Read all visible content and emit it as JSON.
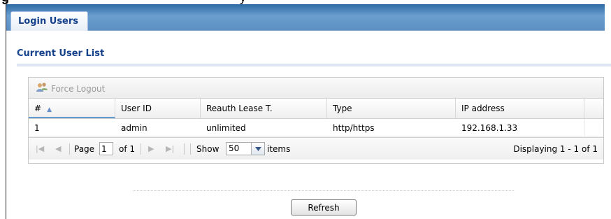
{
  "caption": {
    "prefix": "g",
    "text": "y"
  },
  "tabs": [
    {
      "label": "Login Users",
      "active": true
    }
  ],
  "section": {
    "title": "Current User List"
  },
  "toolbar": {
    "force_logout_label": "Force Logout",
    "force_logout_enabled": false,
    "icon": "users-icon"
  },
  "table": {
    "columns": [
      "#",
      "User ID",
      "Reauth Lease T.",
      "Type",
      "IP address"
    ],
    "sort_column": "#",
    "sort_direction": "ascending",
    "rows": [
      {
        "index": "1",
        "user_id": "admin",
        "reauth": "unlimited",
        "type": "http/https",
        "ip": "192.168.1.33"
      }
    ]
  },
  "pager": {
    "page_label": "Page",
    "page_value": "1",
    "of_label": "of 1",
    "show_label": "Show",
    "per_page": "50",
    "items_label": "items",
    "displaying": "Displaying 1 - 1 of 1"
  },
  "actions": {
    "refresh_label": "Refresh"
  },
  "colors": {
    "tab_bar": "#5d8fc3",
    "section_title": "#15428b",
    "sort_accent": "#6699cc"
  }
}
